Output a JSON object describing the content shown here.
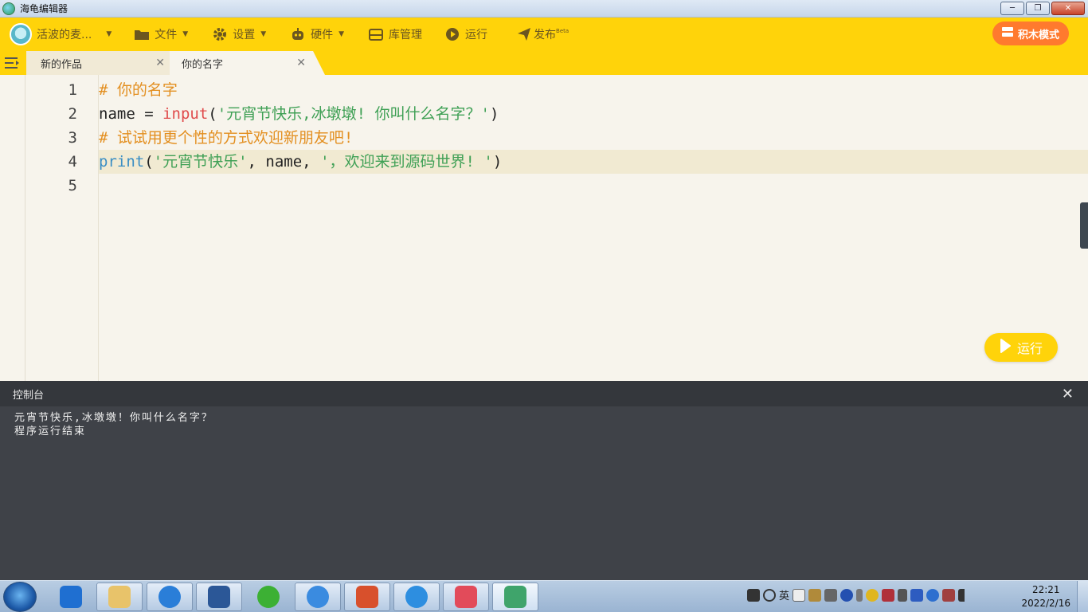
{
  "window": {
    "title": "海龟编辑器"
  },
  "toolbar": {
    "user_name": "活波的麦...",
    "file": "文件",
    "settings": "设置",
    "hardware": "硬件",
    "library": "库管理",
    "run": "运行",
    "publish": "发布",
    "publish_badge": "Beta",
    "block_mode": "积木模式"
  },
  "tabs": [
    {
      "label": "新的作品",
      "active": false
    },
    {
      "label": "你的名字",
      "active": true
    }
  ],
  "editor": {
    "line_numbers": [
      "1",
      "2",
      "3",
      "4",
      "5"
    ],
    "lines": [
      {
        "comment": "# 你的名字"
      },
      {
        "t1": "name = ",
        "kw": "input",
        "t2": "(",
        "str": "'元宵节快乐,冰墩墩! 你叫什么名字？'",
        "t3": ")"
      },
      {
        "comment": "# 试试用更个性的方式欢迎新朋友吧!"
      },
      {
        "fn": "print",
        "t1": "(",
        "str1": "'元宵节快乐'",
        "t2": ", name, ",
        "str2": "'，欢迎来到源码世界! '",
        "t3": ")"
      },
      {}
    ],
    "active_line": 4,
    "run_button": "运行"
  },
  "console": {
    "title": "控制台",
    "output": [
      "元宵节快乐,冰墩墩！你叫什么名字？",
      "程序运行结束"
    ]
  },
  "taskbar": {
    "ime": "英",
    "clock_time": "22:21",
    "clock_date": "2022/2/16"
  },
  "colors": {
    "accent": "#ffd30a",
    "block_mode_bg": "#ff7a2e",
    "comment": "#e38f20",
    "keyword": "#e04b4b",
    "function": "#3a8ec4",
    "string": "#3fa055",
    "console_bg": "#3f4248"
  },
  "icons": {
    "file": "folder-icon",
    "settings": "gear-icon",
    "hardware": "robot-icon",
    "library": "package-icon",
    "run": "play-icon",
    "publish": "paper-plane-icon"
  }
}
